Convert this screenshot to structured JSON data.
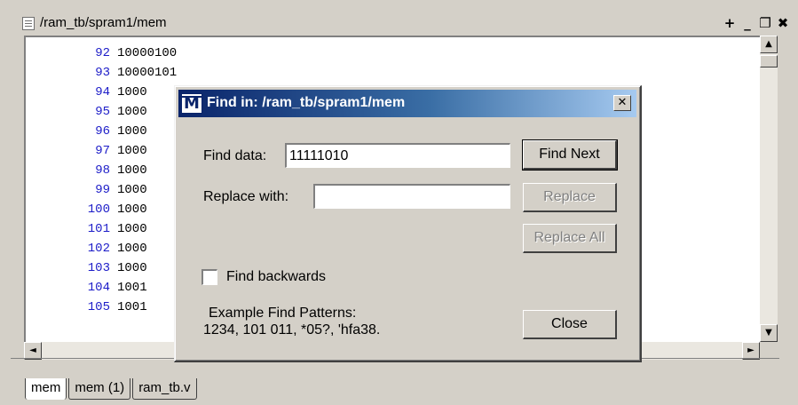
{
  "window": {
    "title": "/ram_tb/spram1/mem",
    "controls": [
      "+",
      "_",
      "❐",
      "✖"
    ]
  },
  "memory": {
    "rows": [
      {
        "addr": "92",
        "val": "10000100"
      },
      {
        "addr": "93",
        "val": "10000101"
      },
      {
        "addr": "94",
        "val": "1000"
      },
      {
        "addr": "95",
        "val": "1000"
      },
      {
        "addr": "96",
        "val": "1000"
      },
      {
        "addr": "97",
        "val": "1000"
      },
      {
        "addr": "98",
        "val": "1000"
      },
      {
        "addr": "99",
        "val": "1000"
      },
      {
        "addr": "100",
        "val": "1000"
      },
      {
        "addr": "101",
        "val": "1000"
      },
      {
        "addr": "102",
        "val": "1000"
      },
      {
        "addr": "103",
        "val": "1000"
      },
      {
        "addr": "104",
        "val": "1001"
      },
      {
        "addr": "105",
        "val": "1001"
      }
    ]
  },
  "scrollbar": {
    "up": "▲",
    "down": "▼",
    "left": "◄",
    "right": "►"
  },
  "tabs": [
    "mem",
    "mem (1)",
    "ram_tb.v"
  ],
  "dialog": {
    "title": "Find in: /ram_tb/spram1/mem",
    "icon_letter": "M",
    "close": "✕",
    "find_label": "Find data:",
    "find_value": "11111010",
    "replace_label": "Replace with:",
    "replace_value": "",
    "find_next": "Find Next",
    "replace": "Replace",
    "replace_all": "Replace All",
    "backwards_label": "Find backwards",
    "backwards_checked": false,
    "example_title": "Example Find Patterns:",
    "example_text": "1234, 101 011, *05?, 'hfa38.",
    "close_button": "Close"
  }
}
